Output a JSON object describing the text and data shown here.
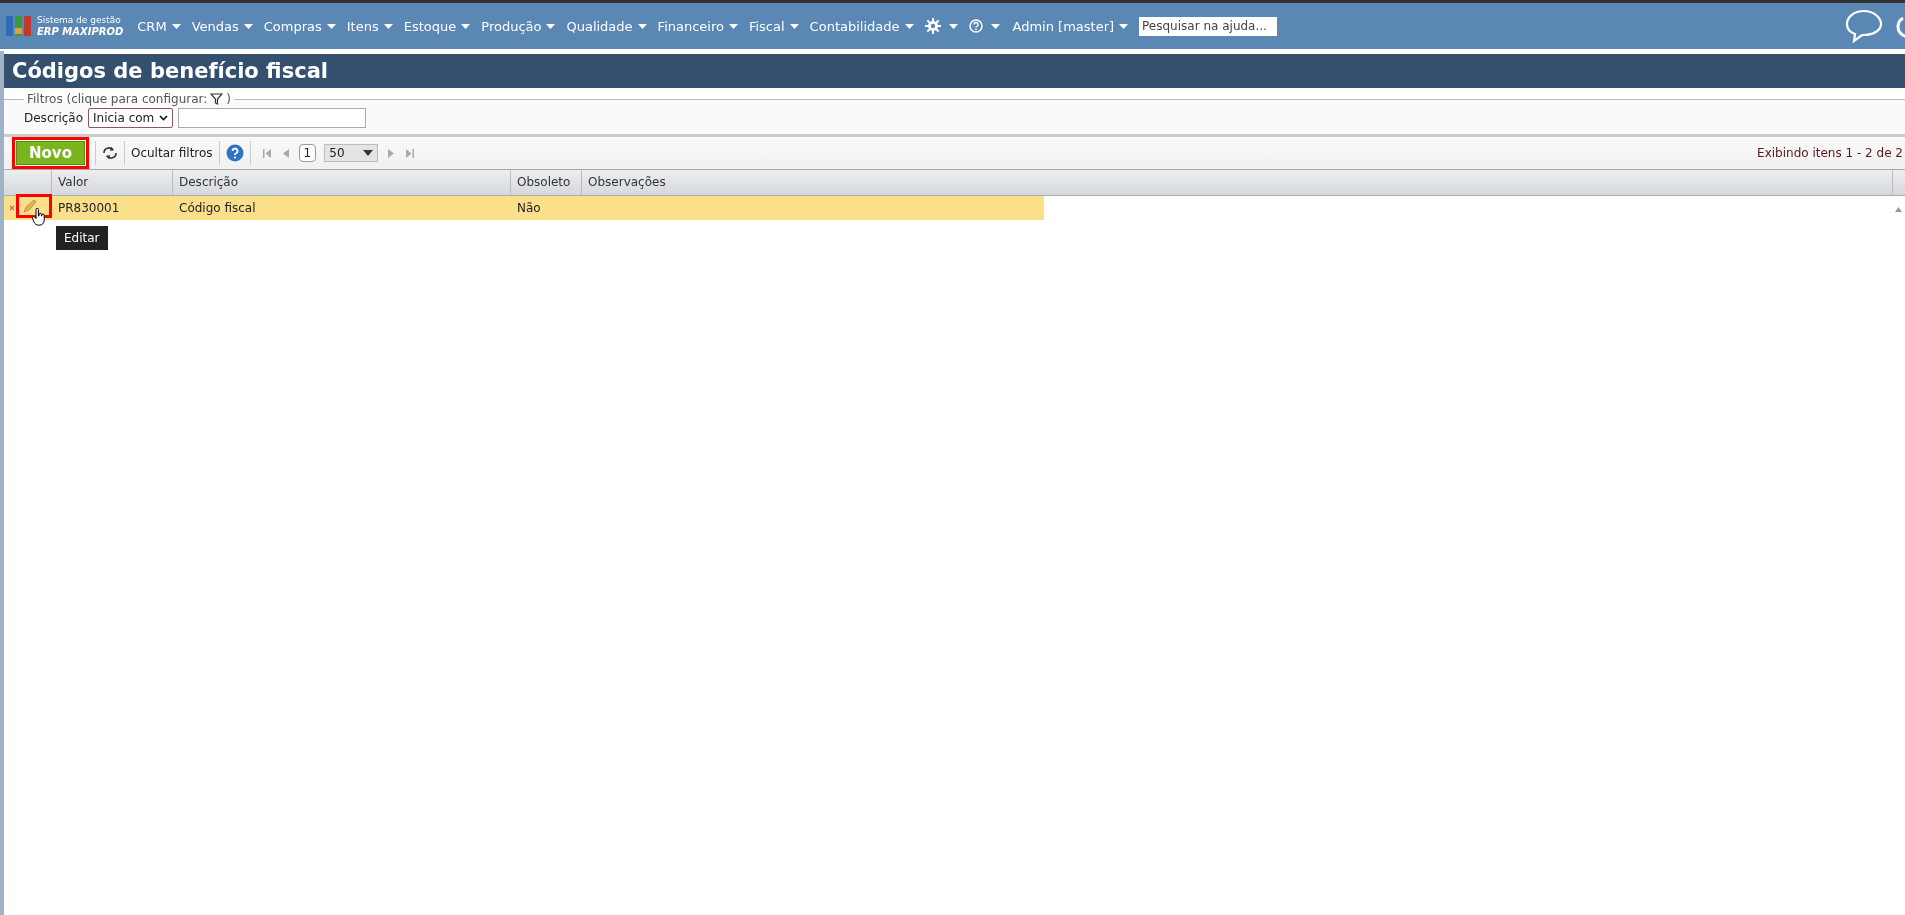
{
  "top_bar": {
    "logo": {
      "line_1": "Sistema de gestão",
      "line_2": "ERP MAXIPROD"
    },
    "menu": [
      {
        "label": "CRM"
      },
      {
        "label": "Vendas"
      },
      {
        "label": "Compras"
      },
      {
        "label": "Itens"
      },
      {
        "label": "Estoque"
      },
      {
        "label": "Produção"
      },
      {
        "label": "Qualidade"
      },
      {
        "label": "Financeiro"
      },
      {
        "label": "Fiscal"
      },
      {
        "label": "Contabilidade"
      }
    ],
    "user": "Admin [master]",
    "search": {
      "placeholder": "Pesquisar na ajuda..."
    }
  },
  "page_title": "Códigos de benefício fiscal",
  "filters": {
    "legend": "Filtros (clique para configurar:",
    "legend_end": ")",
    "field_label": "Descrição",
    "operator": "Inicia com"
  },
  "toolbar": {
    "new_button": "Novo",
    "hide_filters": "Ocultar filtros",
    "page": "1",
    "page_size": "50",
    "summary": "Exibindo itens 1 - 2 de 2"
  },
  "table": {
    "columns": [
      "Valor",
      "Descrição",
      "Obsoleto",
      "Observações"
    ],
    "rows": [
      {
        "cells": [
          "PR830001",
          "Código fiscal",
          "Não"
        ],
        "selected": true
      }
    ]
  },
  "tooltip": "Editar"
}
